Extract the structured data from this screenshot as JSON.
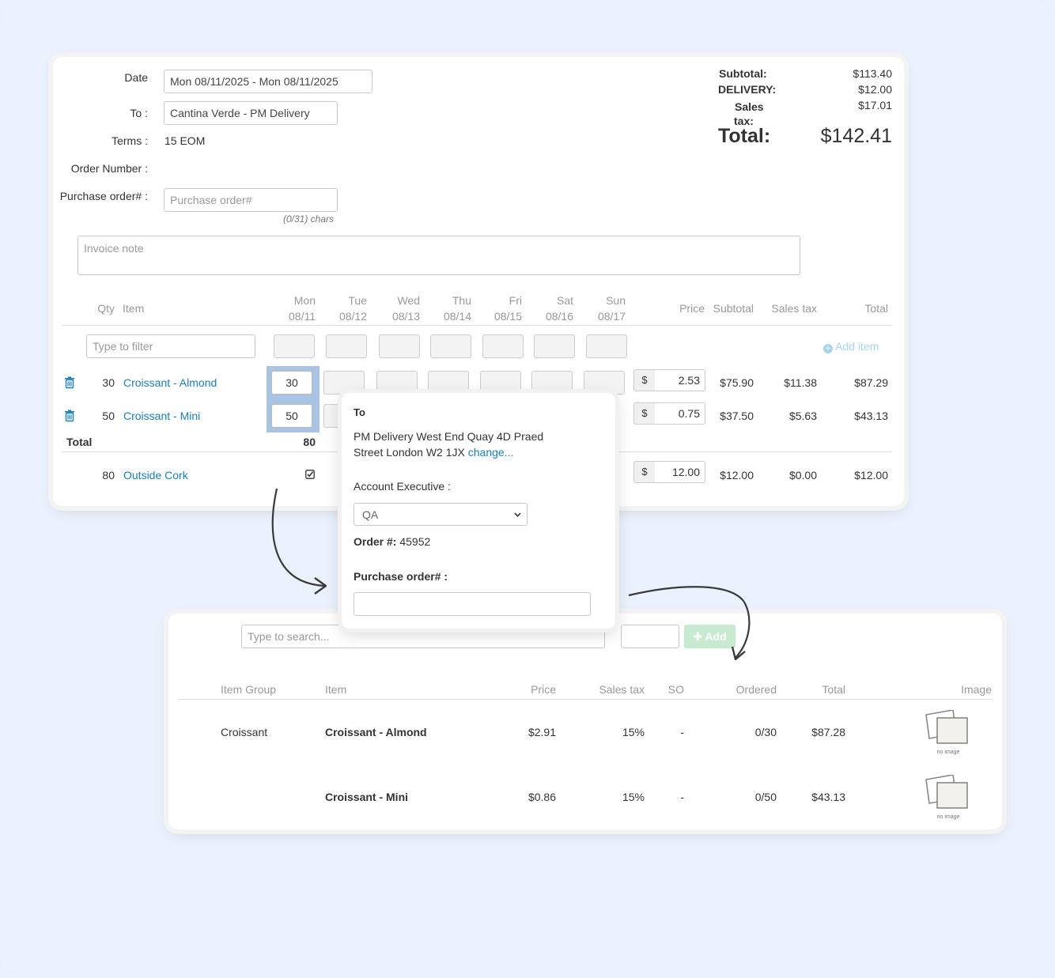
{
  "invoice": {
    "date_label": "Date",
    "date_value": "Mon 08/11/2025 - Mon 08/11/2025",
    "to_label": "To :",
    "to_value": "Cantina Verde -  PM Delivery",
    "terms_label": "Terms :",
    "terms_value": "15 EOM",
    "order_number_label": "Order Number :",
    "po_label": "Purchase order# :",
    "po_placeholder": "Purchase order#",
    "po_chars": "(0/31) chars",
    "note_placeholder": "Invoice note"
  },
  "totals": {
    "subtotal_label": "Subtotal:",
    "subtotal_value": "$113.40",
    "delivery_label": "DELIVERY:",
    "delivery_value": "$12.00",
    "sales_label": "Sales",
    "tax_label": "tax:",
    "sales_tax_value": "$17.01",
    "total_label": "Total:",
    "total_value": "$142.41"
  },
  "grid": {
    "headers": {
      "qty": "Qty",
      "item": "Item",
      "price": "Price",
      "subtotal": "Subtotal",
      "sales_tax": "Sales tax",
      "total": "Total"
    },
    "days": [
      {
        "day": "Mon",
        "date": "08/11"
      },
      {
        "day": "Tue",
        "date": "08/12"
      },
      {
        "day": "Wed",
        "date": "08/13"
      },
      {
        "day": "Thu",
        "date": "08/14"
      },
      {
        "day": "Fri",
        "date": "08/15"
      },
      {
        "day": "Sat",
        "date": "08/16"
      },
      {
        "day": "Sun",
        "date": "08/17"
      }
    ],
    "filter_placeholder": "Type to filter",
    "add_item": "Add item",
    "rows": [
      {
        "qty": "30",
        "item": "Croissant - Almond",
        "mon": "30",
        "price": "2.53",
        "subtotal": "$75.90",
        "tax": "$11.38",
        "total": "$87.29"
      },
      {
        "qty": "50",
        "item": "Croissant - Mini",
        "mon": "50",
        "price": "0.75",
        "subtotal": "$37.50",
        "tax": "$5.63",
        "total": "$43.13"
      }
    ],
    "total_label": "Total",
    "total_qty": "80",
    "extra_row": {
      "qty": "80",
      "item": "Outside Cork",
      "price": "12.00",
      "subtotal": "$12.00",
      "tax": "$0.00",
      "total": "$12.00"
    },
    "currency": "$"
  },
  "popup": {
    "to_label": "To",
    "address_line1": "PM Delivery West End Quay 4D Praed",
    "address_line2": "Street London W2 1JX",
    "change_link": "change...",
    "account_exec_label": "Account Executive :",
    "account_exec_value": "QA",
    "order_label": "Order #:",
    "order_value": "45952",
    "po_label": "Purchase order# :"
  },
  "catalog": {
    "search_placeholder": "Type to search...",
    "add_button": "Add",
    "headers": {
      "group": "Item Group",
      "item": "Item",
      "price": "Price",
      "sales_tax": "Sales tax",
      "so": "SO",
      "ordered": "Ordered",
      "total": "Total",
      "image": "Image"
    },
    "rows": [
      {
        "group": "Croissant",
        "item": "Croissant - Almond",
        "price": "$2.91",
        "tax": "15%",
        "so": "-",
        "ordered": "0/30",
        "total": "$87.28",
        "image_caption": "no image"
      },
      {
        "group": "",
        "item": "Croissant - Mini",
        "price": "$0.86",
        "tax": "15%",
        "so": "-",
        "ordered": "0/50",
        "total": "$43.13",
        "image_caption": "no image"
      }
    ]
  },
  "colors": {
    "link": "#1a7fb5",
    "background": "#ebf2fd",
    "selected_cell": "#a9c3e3",
    "add_button": "#c8ead1"
  }
}
